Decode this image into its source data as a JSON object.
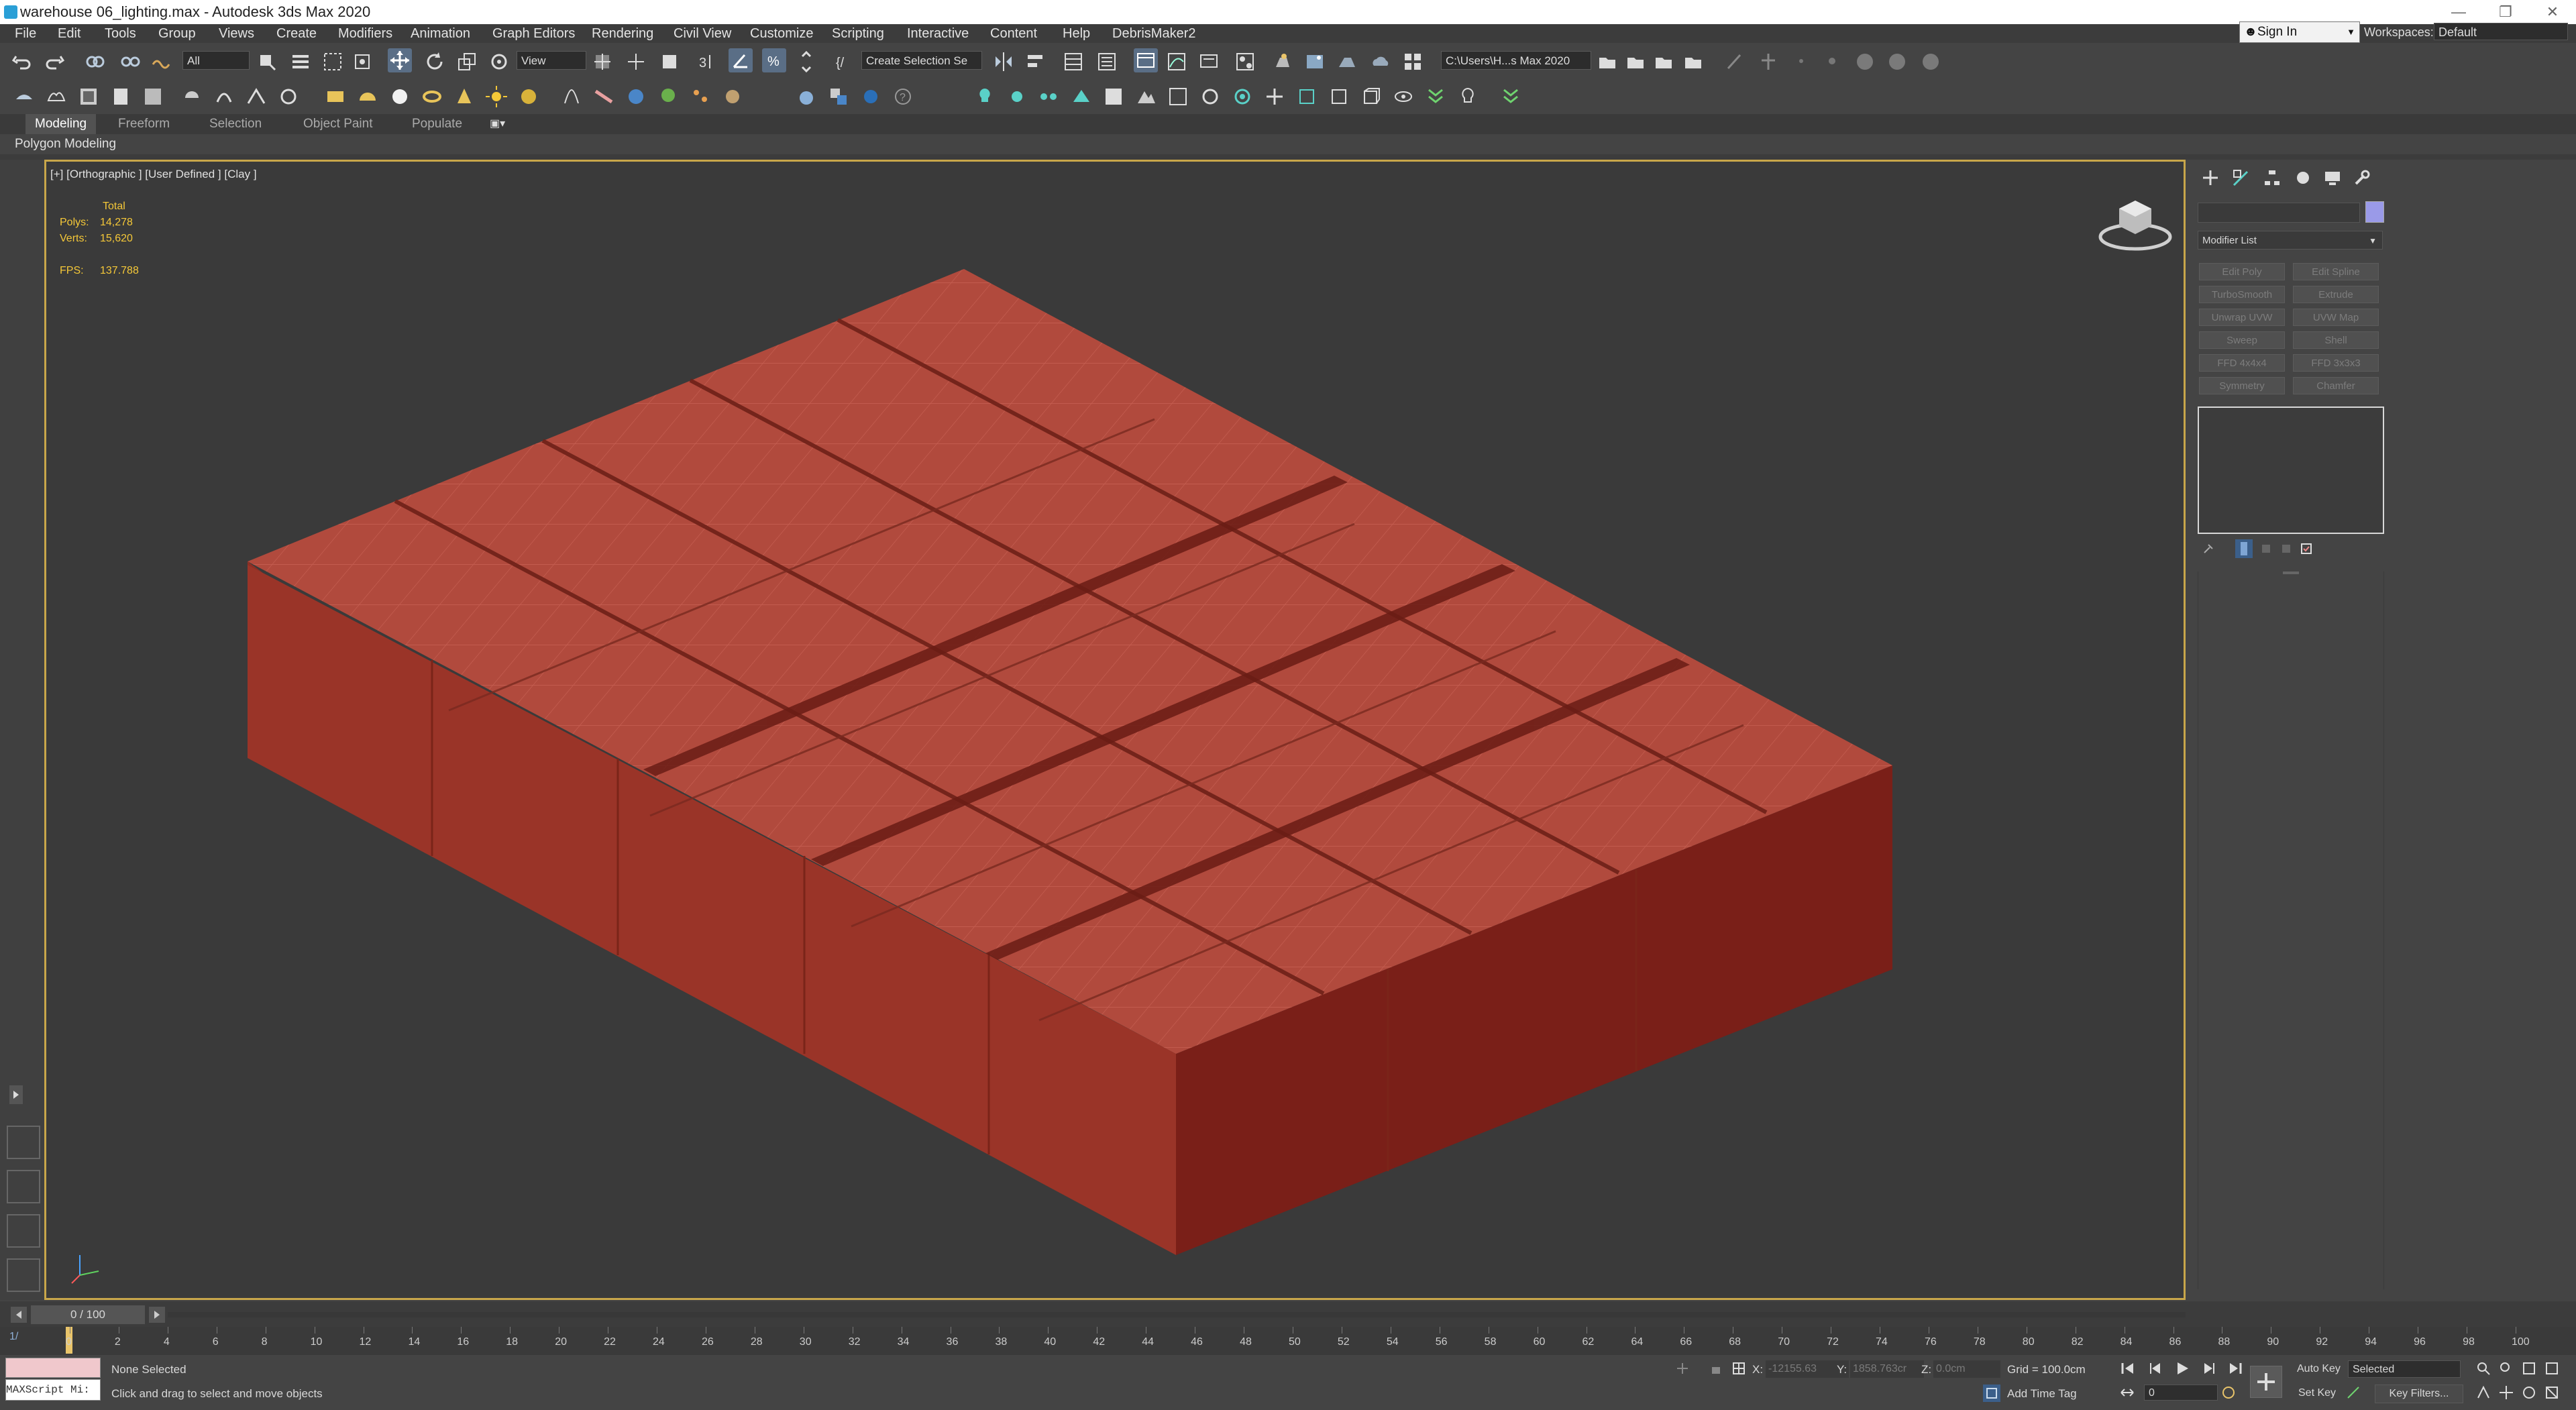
{
  "window": {
    "title": "warehouse 06_lighting.max - Autodesk 3ds Max 2020",
    "minimize_glyph": "—",
    "maximize_glyph": "❐",
    "close_glyph": "✕"
  },
  "menu": [
    "File",
    "Edit",
    "Tools",
    "Group",
    "Views",
    "Create",
    "Modifiers",
    "Animation",
    "Graph Editors",
    "Rendering",
    "Civil View",
    "Customize",
    "Scripting",
    "Interactive",
    "Content",
    "Help",
    "DebrisMaker2"
  ],
  "account": {
    "sign_in": "Sign In",
    "workspaces_label": "Workspaces:",
    "workspace_value": "Default"
  },
  "toolbar": {
    "selection_filter": "All",
    "reference_coord": "View",
    "selection_set": "Create Selection Se",
    "project_path": "C:\\Users\\H...s Max 2020"
  },
  "ribbon": {
    "tabs": [
      "Modeling",
      "Freeform",
      "Selection",
      "Object Paint",
      "Populate"
    ],
    "active_tab": "Modeling",
    "sub_label": "Polygon Modeling"
  },
  "viewport": {
    "label": "[+] [Orthographic ] [User Defined ] [Clay ]",
    "stats": {
      "total_label": "Total",
      "polys_label": "Polys:",
      "polys_value": "14,278",
      "verts_label": "Verts:",
      "verts_value": "15,620",
      "fps_label": "FPS:",
      "fps_value": "137.788"
    }
  },
  "command_panel": {
    "modifier_list_label": "Modifier List",
    "modifier_buttons": [
      "Edit Poly",
      "Edit Spline",
      "TurboSmooth",
      "Extrude",
      "Unwrap UVW",
      "UVW Map",
      "Sweep",
      "Shell",
      "FFD 4x4x4",
      "FFD 3x3x3",
      "Symmetry",
      "Chamfer"
    ]
  },
  "timeline": {
    "frame_display": "0 / 100",
    "ticks": [
      "0",
      "2",
      "4",
      "6",
      "8",
      "10",
      "12",
      "14",
      "16",
      "18",
      "20",
      "22",
      "24",
      "26",
      "28",
      "30",
      "32",
      "34",
      "36",
      "38",
      "40",
      "42",
      "44",
      "46",
      "48",
      "50",
      "52",
      "54",
      "56",
      "58",
      "60",
      "62",
      "64",
      "66",
      "68",
      "70",
      "72",
      "74",
      "76",
      "78",
      "80",
      "82",
      "84",
      "86",
      "88",
      "90",
      "92",
      "94",
      "96",
      "98",
      "100"
    ]
  },
  "status": {
    "maxscript": "MAXScript Mi:",
    "selection_status": "None Selected",
    "prompt": "Click and drag to select and move objects",
    "x_label": "X:",
    "x_value": "-12155.63",
    "y_label": "Y:",
    "y_value": "1858.763cr",
    "z_label": "Z:",
    "z_value": "0.0cm",
    "grid": "Grid = 100.0cm",
    "add_time_tag": "Add Time Tag",
    "auto_key": "Auto Key",
    "selected": "Selected",
    "set_key": "Set Key",
    "key_filters": "Key Filters...",
    "frame_value": "0"
  },
  "colors": {
    "model_roof": "#b54b3e",
    "model_wall_front": "#8a2a20",
    "model_wall_right": "#7a1f18",
    "viewport_bg": "#3a3a3a",
    "active_border": "#c8a64a",
    "stats_text": "#f5c838"
  }
}
